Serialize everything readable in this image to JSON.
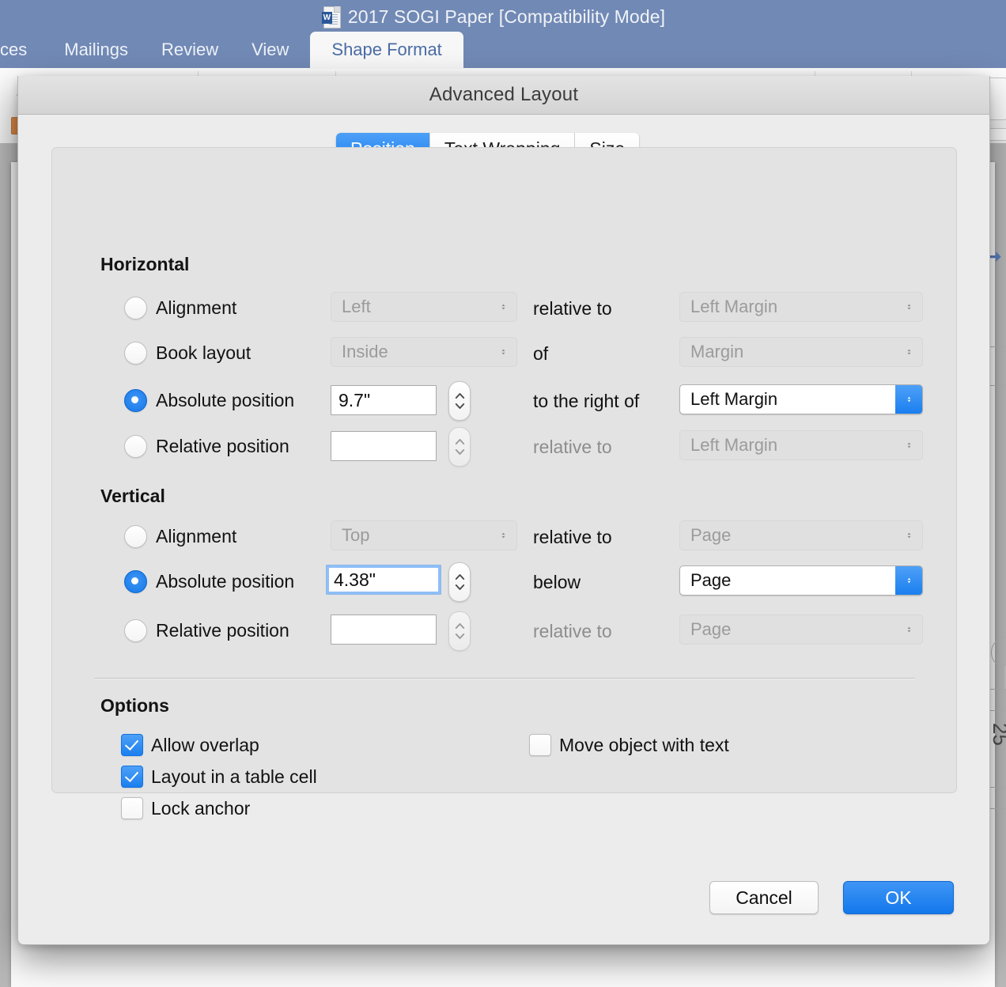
{
  "word": {
    "title": "2017 SOGI Paper [Compatibility Mode]",
    "doc_icon": "word-document-icon",
    "badge": "W",
    "tabs": [
      {
        "label": "ces",
        "active": false
      },
      {
        "label": "Mailings",
        "active": false
      },
      {
        "label": "Review",
        "active": false
      },
      {
        "label": "View",
        "active": false
      },
      {
        "label": "Shape Format",
        "active": true
      }
    ],
    "titlebar_color": "#7189b5",
    "active_tab_text_color": "#4a6ca5"
  },
  "dialog": {
    "title": "Advanced Layout",
    "tabs": [
      {
        "label": "Position",
        "active": true
      },
      {
        "label": "Text Wrapping",
        "active": false
      },
      {
        "label": "Size",
        "active": false
      }
    ],
    "accent_color": "#1b7fef",
    "horizontal": {
      "heading": "Horizontal",
      "rows": [
        {
          "radio_label": "Alignment",
          "selected": false,
          "value_kind": "popup",
          "value": "Left",
          "value_enabled": false,
          "mid_label": "relative to",
          "mid_enabled": true,
          "ref_value": "Left Margin",
          "ref_enabled": false
        },
        {
          "radio_label": "Book layout",
          "selected": false,
          "value_kind": "popup",
          "value": "Inside",
          "value_enabled": false,
          "mid_label": "of",
          "mid_enabled": true,
          "ref_value": "Margin",
          "ref_enabled": false
        },
        {
          "radio_label": "Absolute position",
          "selected": true,
          "value_kind": "field",
          "value": "9.7\"",
          "value_enabled": true,
          "value_focused": false,
          "mid_label": "to the right of",
          "mid_enabled": true,
          "ref_value": "Left Margin",
          "ref_enabled": true
        },
        {
          "radio_label": "Relative position",
          "selected": false,
          "value_kind": "field",
          "value": "",
          "value_enabled": true,
          "value_focused": false,
          "mid_label": "relative to",
          "mid_enabled": false,
          "ref_value": "Left Margin",
          "ref_enabled": false
        }
      ]
    },
    "vertical": {
      "heading": "Vertical",
      "rows": [
        {
          "radio_label": "Alignment",
          "selected": false,
          "value_kind": "popup",
          "value": "Top",
          "value_enabled": false,
          "mid_label": "relative to",
          "mid_enabled": true,
          "ref_value": "Page",
          "ref_enabled": false
        },
        {
          "radio_label": "Absolute position",
          "selected": true,
          "value_kind": "field",
          "value": "4.38\"",
          "value_enabled": true,
          "value_focused": true,
          "mid_label": "below",
          "mid_enabled": true,
          "ref_value": "Page",
          "ref_enabled": true
        },
        {
          "radio_label": "Relative position",
          "selected": false,
          "value_kind": "field",
          "value": "",
          "value_enabled": true,
          "value_focused": false,
          "mid_label": "relative to",
          "mid_enabled": false,
          "ref_value": "Page",
          "ref_enabled": false
        }
      ]
    },
    "options": {
      "heading": "Options",
      "left": [
        {
          "label": "Allow overlap",
          "checked": true
        },
        {
          "label": "Layout in a table cell",
          "checked": true
        },
        {
          "label": "Lock anchor",
          "checked": false
        }
      ],
      "right": [
        {
          "label": "Move object with text",
          "checked": false
        }
      ]
    },
    "buttons": {
      "cancel": "Cancel",
      "ok": "OK"
    }
  }
}
